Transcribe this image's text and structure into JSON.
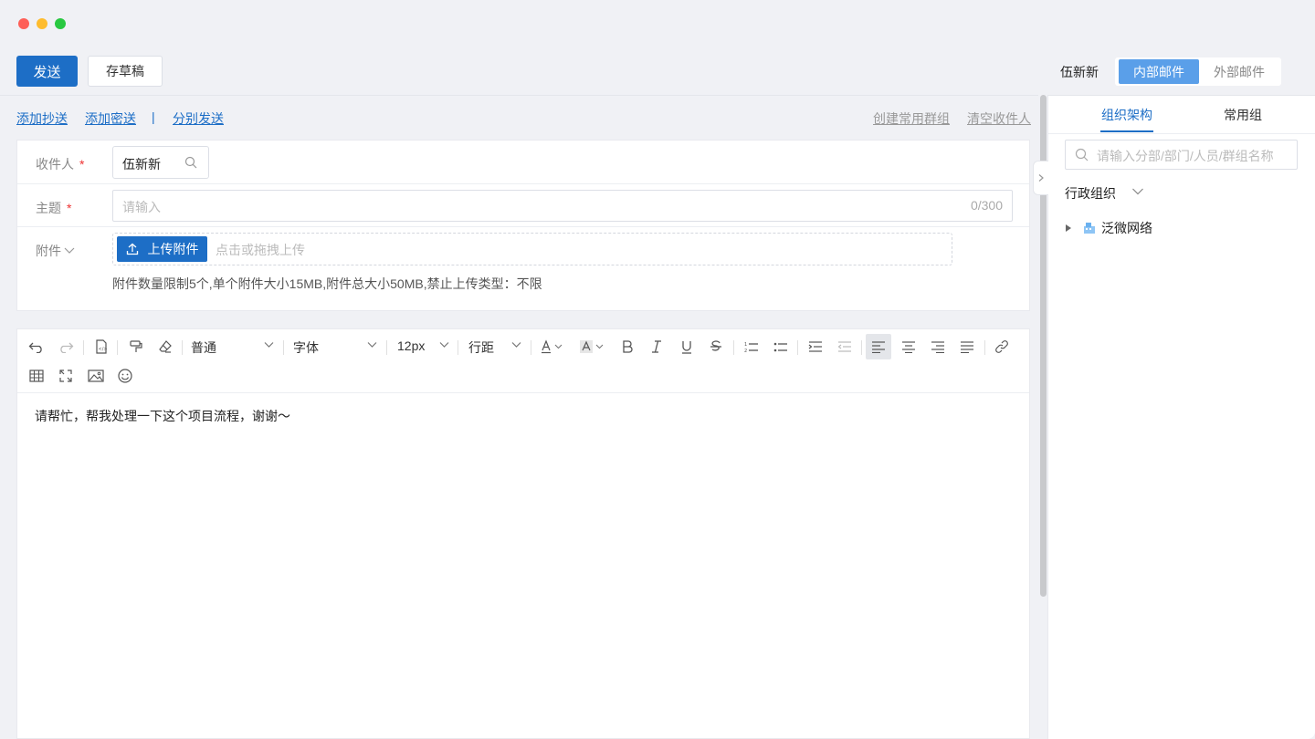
{
  "toolbar": {
    "send_label": "发送",
    "draft_label": "存草稿",
    "user_name": "伍新新",
    "mail_tabs": [
      {
        "label": "内部邮件",
        "active": true
      },
      {
        "label": "外部邮件",
        "active": false
      }
    ]
  },
  "links": {
    "add_cc": "添加抄送",
    "add_bcc": "添加密送",
    "separator": "|",
    "separate_send": "分别发送",
    "create_group": "创建常用群组",
    "clear_recipients": "清空收件人"
  },
  "form": {
    "recipient_label": "收件人",
    "recipient_required": "*",
    "recipient_value": "伍新新",
    "subject_label": "主题",
    "subject_required": "*",
    "subject_placeholder": "请输入",
    "subject_count": "0/300",
    "attach_label": "附件",
    "upload_button": "上传附件",
    "upload_placeholder": "点击或拖拽上传",
    "attach_note": "附件数量限制5个,单个附件大小15MB,附件总大小50MB,禁止上传类型：不限"
  },
  "editor": {
    "paragraph_style": "普通",
    "font_family": "字体",
    "font_size": "12px",
    "line_height": "行距",
    "body_text": "请帮忙，帮我处理一下这个项目流程，谢谢～"
  },
  "side": {
    "tabs": [
      {
        "label": "组织架构",
        "active": true
      },
      {
        "label": "常用组",
        "active": false
      }
    ],
    "search_placeholder": "请输入分部/部门/人员/群组名称",
    "org_select": "行政组织",
    "tree_root": "泛微网络"
  },
  "colors": {
    "primary": "#1d6ec6",
    "segment_active": "#5a9fe9"
  }
}
